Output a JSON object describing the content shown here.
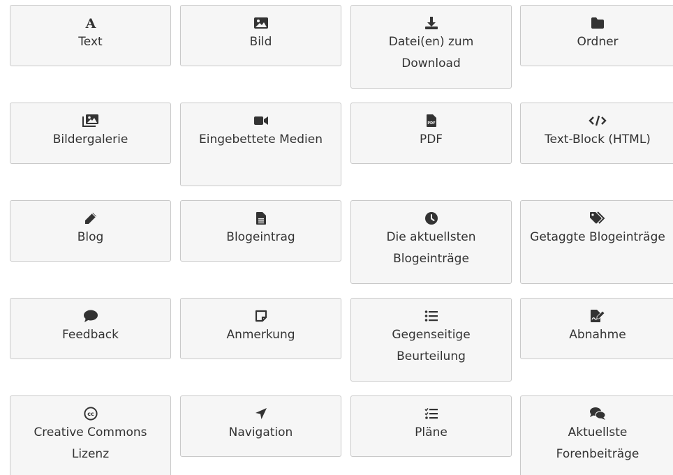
{
  "tiles": [
    {
      "label": "Text",
      "icon": "text-font-icon"
    },
    {
      "label": "Bild",
      "icon": "image-icon"
    },
    {
      "label": "Datei(en) zum Download",
      "icon": "download-icon"
    },
    {
      "label": "Ordner",
      "icon": "folder-icon"
    },
    {
      "label": "Bildergalerie",
      "icon": "image-gallery-icon"
    },
    {
      "label": "Eingebettete Medien",
      "icon": "video-camera-icon"
    },
    {
      "label": "PDF",
      "icon": "pdf-file-icon"
    },
    {
      "label": "Text-Block (HTML)",
      "icon": "code-icon"
    },
    {
      "label": "Blog",
      "icon": "pencil-icon"
    },
    {
      "label": "Blogeintrag",
      "icon": "document-icon"
    },
    {
      "label": "Die aktuellsten Blogeinträge",
      "icon": "clock-icon"
    },
    {
      "label": "Getaggte Blogeinträge",
      "icon": "tags-icon"
    },
    {
      "label": "Feedback",
      "icon": "comment-icon"
    },
    {
      "label": "Anmerkung",
      "icon": "sticky-note-icon"
    },
    {
      "label": "Gegenseitige Beurteilung",
      "icon": "list-icon"
    },
    {
      "label": "Abnahme",
      "icon": "signature-icon"
    },
    {
      "label": "Creative Commons Lizenz",
      "icon": "creative-commons-icon"
    },
    {
      "label": "Navigation",
      "icon": "location-arrow-icon"
    },
    {
      "label": "Pläne",
      "icon": "checklist-icon"
    },
    {
      "label": "Aktuellste Forenbeiträge",
      "icon": "comments-icon"
    }
  ]
}
